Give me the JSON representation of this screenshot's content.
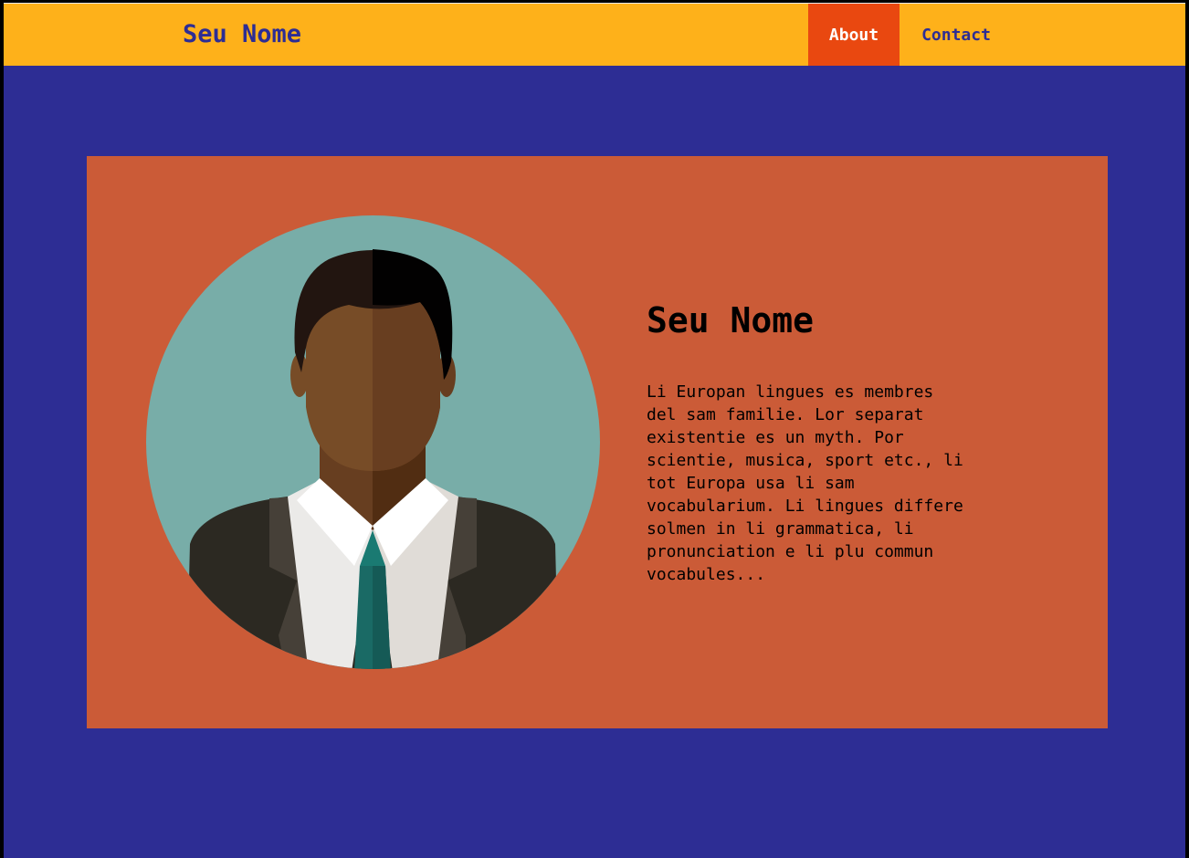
{
  "navbar": {
    "brand": "Seu Nome",
    "items": [
      {
        "label": "About",
        "active": true
      },
      {
        "label": "Contact",
        "active": false
      }
    ]
  },
  "profile": {
    "name": "Seu Nome",
    "bio": "Li Europan lingues es membres\ndel sam familie. Lor separat\nexistentie es un myth. Por\nscientie, musica, sport etc., li\ntot Europa usa li sam\nvocabularium. Li lingues differe\nsolmen in li grammatica, li\npronunciation e li plu commun\nvocabules...",
    "avatar_icon": "person-avatar-icon"
  },
  "colors": {
    "page_background": "#2d2d94",
    "navbar": "#feb11a",
    "nav_active": "#e94810",
    "card": "#cb5b37",
    "avatar_circle": "#78ada8"
  }
}
